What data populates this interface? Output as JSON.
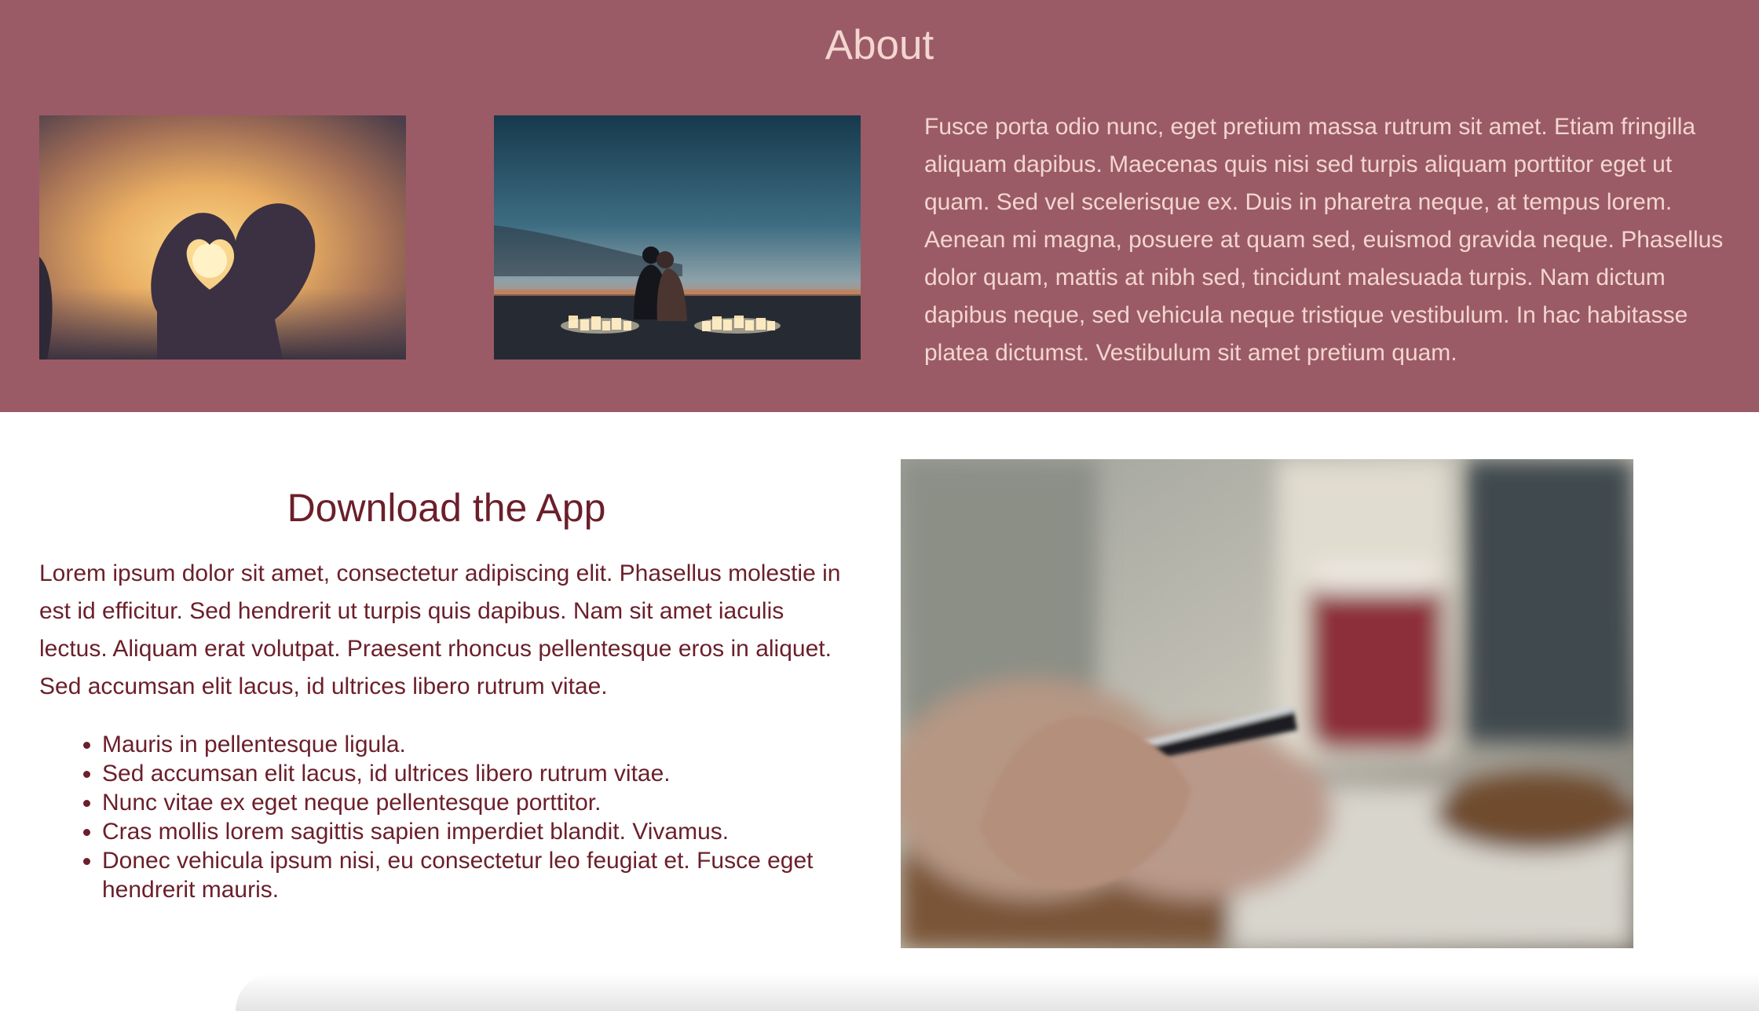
{
  "about": {
    "title": "About",
    "paragraph": "Fusce porta odio nunc, eget pretium massa rutrum sit amet. Etiam fringilla aliquam dapibus. Maecenas quis nisi sed turpis aliquam porttitor eget ut quam. Sed vel scelerisque ex. Duis in pharetra neque, at tempus lorem. Aenean mi magna, posuere at quam sed, euismod gravida neque. Phasellus dolor quam, mattis at nibh sed, tincidunt malesuada turpis. Nam dictum dapibus neque, sed vehicula neque tristique vestibulum. In hac habitasse platea dictumst. Vestibulum sit amet pretium quam.",
    "background_color": "#9a5b66",
    "text_color": "#f3d6cf"
  },
  "download": {
    "title": "Download the App",
    "paragraph": "Lorem ipsum dolor sit amet, consectetur adipiscing elit. Phasellus molestie in est id efficitur. Sed hendrerit ut turpis quis dapibus. Nam sit amet iaculis lectus. Aliquam erat volutpat. Praesent rhoncus pellentesque eros in aliquet. Sed accumsan elit lacus, id ultrices libero rutrum vitae.",
    "items": [
      "Mauris in pellentesque ligula.",
      "Sed accumsan elit lacus, id ultrices libero rutrum vitae.",
      "Nunc vitae ex eget neque pellentesque porttitor.",
      "Cras mollis lorem sagittis sapien imperdiet blandit. Vivamus.",
      "Donec vehicula ipsum nisi, eu consectetur leo feugiat et. Fusce eget hendrerit mauris."
    ],
    "text_color": "#6b1f2a"
  }
}
